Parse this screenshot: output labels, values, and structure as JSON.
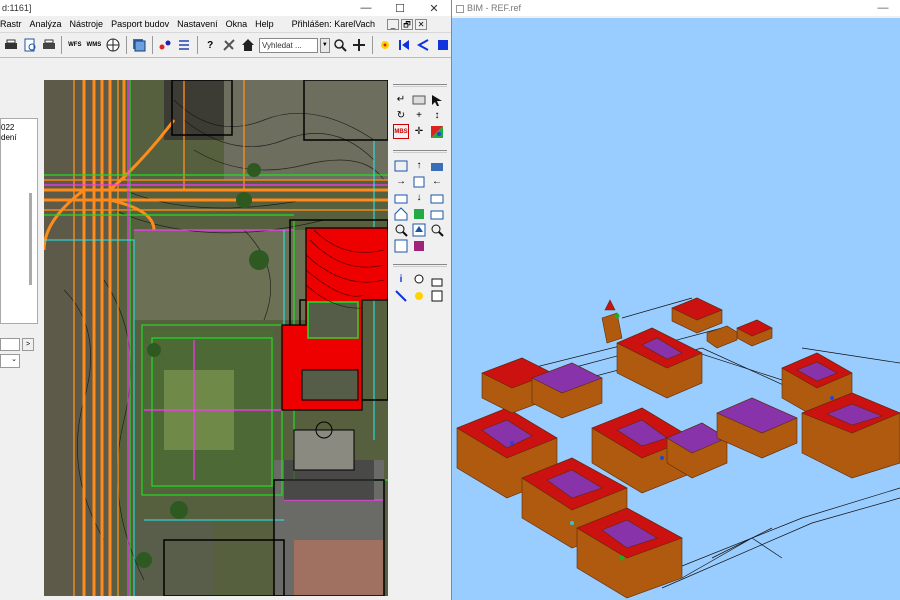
{
  "left_window": {
    "title": "d:1161]",
    "controls": {
      "minimize": "—",
      "maximize": "☐",
      "close": "✕"
    },
    "menu": [
      "Rastr",
      "Analýza",
      "Nástroje",
      "Pasport budov",
      "Nastavení",
      "Okna",
      "Help"
    ],
    "logged_in": "Přihlášen: KarelVach",
    "mdi_controls": [
      "_",
      "🗗",
      "✕"
    ],
    "search": {
      "value": "Vyhledat ...",
      "placeholder": "Vyhledat ..."
    },
    "toolbar_icons": [
      "printer-icon",
      "print-preview-icon",
      "print-setup-icon",
      "wfs-icon",
      "wms-icon",
      "globe-icon",
      "layers-icon",
      "select-icon",
      "list-icon",
      "help-icon",
      "tools-icon",
      "home-icon",
      "zoom-icon",
      "pan-icon",
      "marker-icon",
      "first-icon",
      "back-icon",
      "stop-icon"
    ],
    "toolbar_labels": {
      "wfs": "WFS",
      "wms": "WMS"
    },
    "left_panel": {
      "line1": "022",
      "line2": "dení",
      "next": ">"
    },
    "tool_panel_label": "MBS"
  },
  "right_window": {
    "title": "BIM - REF.ref",
    "controls": {
      "minimize": "—"
    }
  },
  "colors": {
    "map_orange": "#ff8c1a",
    "map_red": "#ee0000",
    "sky": "#99ccff",
    "building_wall": "#b05a10",
    "roof_red": "#cc1111",
    "roof_purple": "#8833aa"
  }
}
